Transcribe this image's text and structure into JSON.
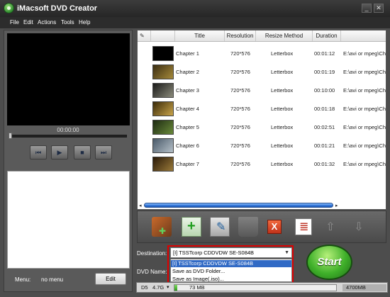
{
  "window": {
    "title": "iMacsoft DVD Creator",
    "min_glyph": "_",
    "close_glyph": "✕"
  },
  "menubar": {
    "items": [
      "File",
      "Edit",
      "Actions",
      "Tools",
      "Help"
    ]
  },
  "player": {
    "timecode": "00:00:00"
  },
  "menu_section": {
    "label": "Menu:",
    "value": "no menu",
    "edit_button": "Edit"
  },
  "table": {
    "columns": [
      "Title",
      "Resolution",
      "Resize Method",
      "Duration"
    ],
    "rows": [
      {
        "title": "Chapter 1",
        "resolution": "720*576",
        "resize": "Letterbox",
        "duration": "00:01:12",
        "path": "E:\\avi or mpeg\\Ch"
      },
      {
        "title": "Chapter 2",
        "resolution": "720*576",
        "resize": "Letterbox",
        "duration": "00:01:19",
        "path": "E:\\avi or mpeg\\Ch"
      },
      {
        "title": "Chapter 3",
        "resolution": "720*576",
        "resize": "Letterbox",
        "duration": "00:10:00",
        "path": "E:\\avi or mpeg\\Ch"
      },
      {
        "title": "Chapter 4",
        "resolution": "720*576",
        "resize": "Letterbox",
        "duration": "00:01:18",
        "path": "E:\\avi or mpeg\\Ch"
      },
      {
        "title": "Chapter 5",
        "resolution": "720*576",
        "resize": "Letterbox",
        "duration": "00:02:51",
        "path": "E:\\avi or mpeg\\Ch"
      },
      {
        "title": "Chapter 6",
        "resolution": "720*576",
        "resize": "Letterbox",
        "duration": "00:01:21",
        "path": "E:\\avi or mpeg\\Ch"
      },
      {
        "title": "Chapter 7",
        "resolution": "720*576",
        "resize": "Letterbox",
        "duration": "00:01:32",
        "path": "E:\\avi or mpeg\\Ch"
      }
    ]
  },
  "toolbar": {
    "icons": [
      "add-video-icon",
      "add-file-icon",
      "edit-video-icon",
      "trash-icon",
      "remove-icon",
      "chapter-list-icon",
      "move-up-icon",
      "move-down-icon"
    ],
    "remove_glyph": "X",
    "up_glyph": "⇧",
    "down_glyph": "⇩"
  },
  "destination": {
    "label": "Destination:",
    "selected": "[I] TSSTcorp CDDVDW SE-S084B",
    "options": [
      "[I] TSSTcorp CDDVDW SE-S084B",
      "Save as DVD Folder...",
      "Save as Image(.iso)..."
    ]
  },
  "dvd_name": {
    "label": "DVD Name:"
  },
  "start_button": "Start",
  "status": {
    "disc_type": "D5",
    "capacity": "4.7G",
    "used": "73 MB",
    "used_fraction": 0.016,
    "total": "4700MB"
  }
}
